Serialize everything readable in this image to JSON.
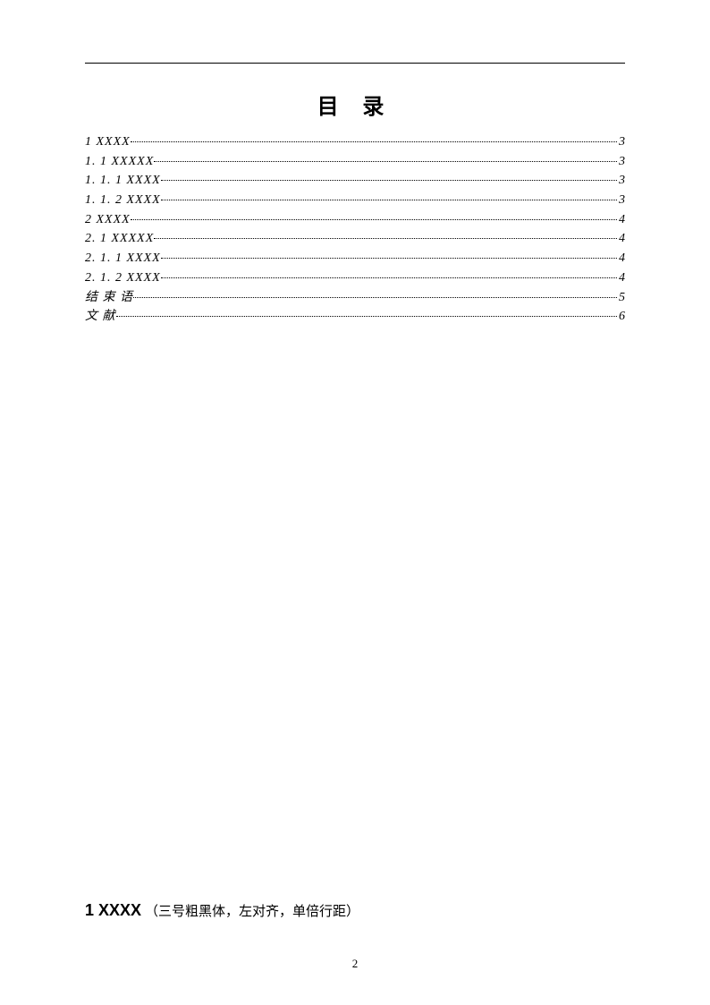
{
  "title": "目 录",
  "toc": [
    {
      "label": "1 XXXX",
      "page": "3"
    },
    {
      "label": "1. 1 XXXXX",
      "page": "3"
    },
    {
      "label": "1. 1. 1 XXXX",
      "page": "3"
    },
    {
      "label": "1. 1. 2 XXXX",
      "page": "3"
    },
    {
      "label": "2 XXXX",
      "page": "4"
    },
    {
      "label": "2. 1 XXXXX",
      "page": "4"
    },
    {
      "label": "2. 1. 1 XXXX",
      "page": "4"
    },
    {
      "label": "2. 1. 2 XXXX",
      "page": "4"
    },
    {
      "label": "结 束 语",
      "page": "5"
    },
    {
      "label": "文 献",
      "page": "6"
    }
  ],
  "section": {
    "head": "1  XXXX",
    "note": "（三号粗黑体，左对齐，单倍行距）"
  },
  "page_number": "2"
}
